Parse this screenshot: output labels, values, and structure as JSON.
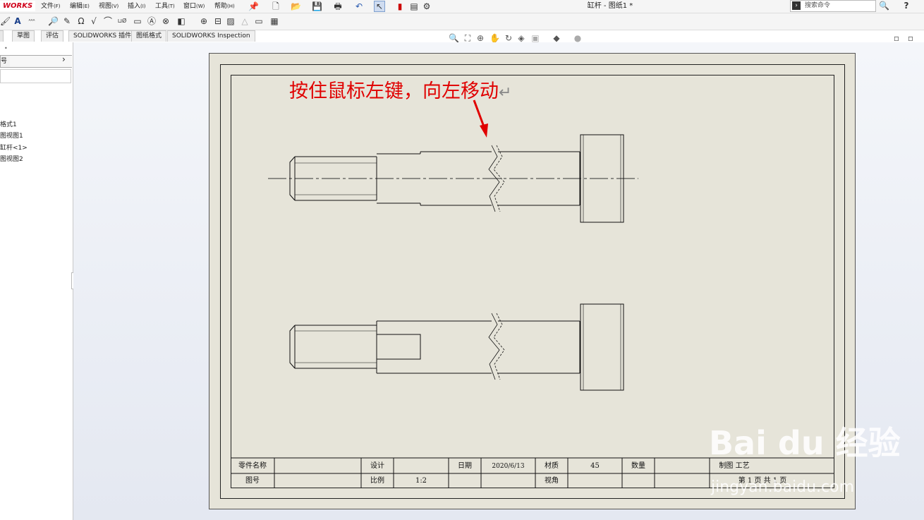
{
  "app": {
    "logo": "WORKS",
    "title": "缸杆 - 图纸1 *"
  },
  "menu": [
    {
      "label": "文件",
      "sc": "(F)"
    },
    {
      "label": "编辑",
      "sc": "(E)"
    },
    {
      "label": "视图",
      "sc": "(V)"
    },
    {
      "label": "插入",
      "sc": "(I)"
    },
    {
      "label": "工具",
      "sc": "(T)"
    },
    {
      "label": "窗口",
      "sc": "(W)"
    },
    {
      "label": "帮助",
      "sc": "(H)"
    }
  ],
  "search": {
    "placeholder": "搜索命令"
  },
  "help_label": "? ",
  "tabs": [
    "草图",
    "评估",
    "SOLIDWORKS 插件",
    "图纸格式",
    "SOLIDWORKS Inspection"
  ],
  "sidebar": {
    "header_label": "号",
    "tree": [
      "格式1",
      "图视图1",
      "缸杆<1>",
      "图视图2"
    ]
  },
  "annotation": {
    "text": "按住鼠标左键，向左移动",
    "return_mark": "↵"
  },
  "title_block": {
    "row1": [
      "零件名称",
      "",
      "设计",
      "",
      "日期",
      "2020/6/13",
      "材质",
      "45",
      "数量",
      "",
      "制图 工艺"
    ],
    "row2": [
      "图号",
      "",
      "比例",
      "1:2",
      "",
      "",
      "视角",
      "",
      "",
      "",
      "第 1 页  共 1 页"
    ]
  },
  "watermark": {
    "logo": "Bai du 经验",
    "url": "jingyan.baidu.com"
  },
  "colors": {
    "annotation": "#e00000",
    "sheet": "#e6e4d9",
    "logo": "#d0021b"
  }
}
